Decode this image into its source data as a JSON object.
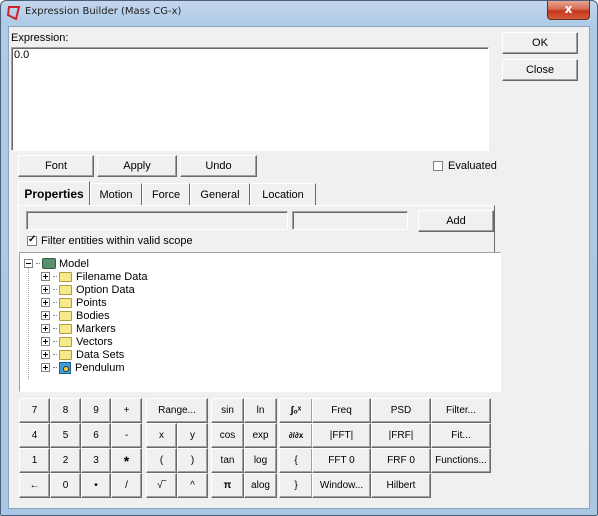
{
  "window": {
    "title": "Expression Builder (Mass CG-x)",
    "close_glyph": "x"
  },
  "expression": {
    "label": "Expression:",
    "value": "0.0"
  },
  "side_buttons": {
    "ok": "OK",
    "close": "Close"
  },
  "edit_buttons": {
    "font": "Font",
    "apply": "Apply",
    "undo": "Undo"
  },
  "evaluated": {
    "label": "Evaluated",
    "checked": false
  },
  "tabs": [
    {
      "label": "Properties",
      "active": true
    },
    {
      "label": "Motion",
      "active": false
    },
    {
      "label": "Force",
      "active": false
    },
    {
      "label": "General",
      "active": false
    },
    {
      "label": "Location",
      "active": false
    }
  ],
  "entity_panel": {
    "field1_value": "",
    "field2_value": "",
    "add_label": "Add",
    "filter_label": "Filter entities within valid scope",
    "filter_checked": true,
    "check_glyph": "✓"
  },
  "tree": {
    "root": {
      "label": "Model",
      "icon": "model-icon",
      "expanded": true
    },
    "children": [
      {
        "label": "Filename Data",
        "icon": "folder-icon"
      },
      {
        "label": "Option Data",
        "icon": "folder-icon"
      },
      {
        "label": "Points",
        "icon": "folder-icon"
      },
      {
        "label": "Bodies",
        "icon": "folder-icon"
      },
      {
        "label": "Markers",
        "icon": "folder-icon"
      },
      {
        "label": "Vectors",
        "icon": "folder-icon"
      },
      {
        "label": "Data Sets",
        "icon": "folder-icon"
      },
      {
        "label": "Pendulum",
        "icon": "pendulum-icon"
      }
    ]
  },
  "keypad": {
    "digits": [
      [
        "7",
        "8",
        "9",
        "+"
      ],
      [
        "4",
        "5",
        "6",
        "-"
      ],
      [
        "1",
        "2",
        "3",
        "*"
      ],
      [
        "←",
        "0",
        "•",
        "/"
      ]
    ],
    "vars": {
      "range": "Range...",
      "x": "x",
      "y": "y",
      "lparen": "(",
      "rparen": ")",
      "sqrt": "√‾",
      "caret": "^"
    },
    "funcs": [
      [
        "sin",
        "ln",
        "∫ₒˣ"
      ],
      [
        "cos",
        "exp",
        "∂/∂x"
      ],
      [
        "tan",
        "log",
        "{"
      ],
      [
        "π",
        "alog",
        "}"
      ]
    ],
    "signal": [
      [
        "Freq",
        "PSD",
        "Filter..."
      ],
      [
        "|FFT|",
        "|FRF|",
        "Fit..."
      ],
      [
        "FFT 0",
        "FRF 0",
        "Functions..."
      ],
      [
        "Window...",
        "Hilbert"
      ]
    ]
  }
}
